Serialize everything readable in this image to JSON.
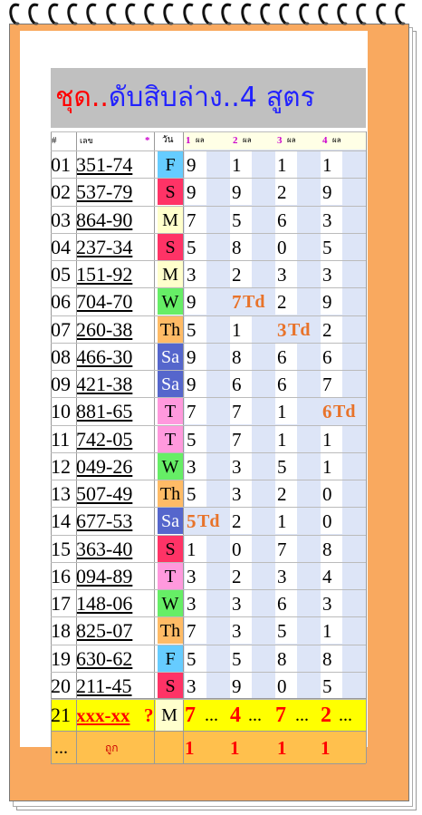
{
  "title": {
    "part1": "ชุด..",
    "part2": "ดับสิบล่าง..4",
    "part3": "สูตร"
  },
  "header": {
    "col_no": "#",
    "col_code": "เลข",
    "col_star": "*",
    "col_day": "วัน",
    "f1": "1",
    "f2": "2",
    "f3": "3",
    "f4": "4",
    "res": "ผล"
  },
  "day_colors": {
    "F": "#66ccff",
    "S": "#ff3366",
    "M": "#ffffcc",
    "W": "#66ee66",
    "Th": "#ffbb66",
    "Sa": "#5566cc",
    "T": "#ff99dd"
  },
  "rows": [
    {
      "no": "01",
      "code": "351-74",
      "day": "F",
      "v": [
        "9",
        "1",
        "1",
        "1"
      ],
      "td": ""
    },
    {
      "no": "02",
      "code": "537-79",
      "day": "S",
      "v": [
        "9",
        "9",
        "2",
        "9"
      ],
      "td": ""
    },
    {
      "no": "03",
      "code": "864-90",
      "day": "M",
      "v": [
        "7",
        "5",
        "6",
        "3"
      ],
      "td": ""
    },
    {
      "no": "04",
      "code": "237-34",
      "day": "S",
      "v": [
        "5",
        "8",
        "0",
        "5"
      ],
      "td": ""
    },
    {
      "no": "05",
      "code": "151-92",
      "day": "M",
      "v": [
        "3",
        "2",
        "3",
        "3"
      ],
      "td": ""
    },
    {
      "no": "06",
      "code": "704-70",
      "day": "W",
      "v": [
        "9",
        "7",
        "2",
        "9"
      ],
      "td": "2"
    },
    {
      "no": "07",
      "code": "260-38",
      "day": "Th",
      "v": [
        "5",
        "1",
        "3",
        "2"
      ],
      "td": "3"
    },
    {
      "no": "08",
      "code": "466-30",
      "day": "Sa",
      "v": [
        "9",
        "8",
        "6",
        "6"
      ],
      "td": ""
    },
    {
      "no": "09",
      "code": "421-38",
      "day": "Sa",
      "v": [
        "9",
        "6",
        "6",
        "7"
      ],
      "td": ""
    },
    {
      "no": "10",
      "code": "881-65",
      "day": "T",
      "v": [
        "7",
        "7",
        "1",
        "6"
      ],
      "td": "4"
    },
    {
      "no": "11",
      "code": "742-05",
      "day": "T",
      "v": [
        "5",
        "7",
        "1",
        "1"
      ],
      "td": ""
    },
    {
      "no": "12",
      "code": "049-26",
      "day": "W",
      "v": [
        "3",
        "3",
        "5",
        "1"
      ],
      "td": ""
    },
    {
      "no": "13",
      "code": "507-49",
      "day": "Th",
      "v": [
        "5",
        "3",
        "2",
        "0"
      ],
      "td": ""
    },
    {
      "no": "14",
      "code": "677-53",
      "day": "Sa",
      "v": [
        "5",
        "2",
        "1",
        "0"
      ],
      "td": "1"
    },
    {
      "no": "15",
      "code": "363-40",
      "day": "S",
      "v": [
        "1",
        "0",
        "7",
        "8"
      ],
      "td": ""
    },
    {
      "no": "16",
      "code": "094-89",
      "day": "T",
      "v": [
        "3",
        "2",
        "3",
        "4"
      ],
      "td": ""
    },
    {
      "no": "17",
      "code": "148-06",
      "day": "W",
      "v": [
        "3",
        "3",
        "6",
        "3"
      ],
      "td": ""
    },
    {
      "no": "18",
      "code": "825-07",
      "day": "Th",
      "v": [
        "7",
        "3",
        "5",
        "1"
      ],
      "td": ""
    },
    {
      "no": "19",
      "code": "630-62",
      "day": "F",
      "v": [
        "5",
        "5",
        "8",
        "8"
      ],
      "td": ""
    },
    {
      "no": "20",
      "code": "211-45",
      "day": "S",
      "v": [
        "3",
        "9",
        "0",
        "5"
      ],
      "td": ""
    }
  ],
  "td_label": "Td",
  "row21": {
    "no": "21",
    "code": "xxx-xx",
    "q": "?",
    "day": "M",
    "v": [
      "7",
      "4",
      "7",
      "2"
    ],
    "dots": "..."
  },
  "row22": {
    "no": "...",
    "label": "ถูก",
    "v": [
      "1",
      "1",
      "1",
      "1"
    ]
  }
}
